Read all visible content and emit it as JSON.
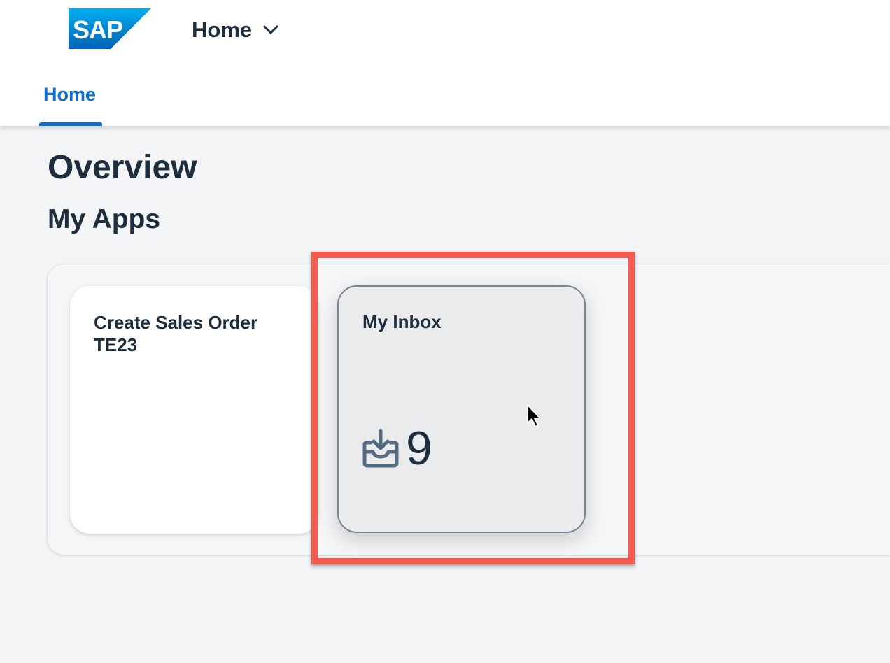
{
  "shell": {
    "logo_text": "SAP",
    "title": "Home",
    "chevron_icon": "chevron-down-icon"
  },
  "tabs": [
    {
      "label": "Home",
      "selected": true
    }
  ],
  "page": {
    "title": "Overview",
    "section_title": "My Apps"
  },
  "tiles": [
    {
      "title": "Create Sales Order TE23"
    },
    {
      "title": "My Inbox",
      "icon": "inbox-download-icon",
      "kpi_value": "9"
    }
  ],
  "colors": {
    "accent": "#0a6ed1",
    "highlight": "#f55a4e",
    "text": "#1d2d3e",
    "icon": "#556b82"
  }
}
